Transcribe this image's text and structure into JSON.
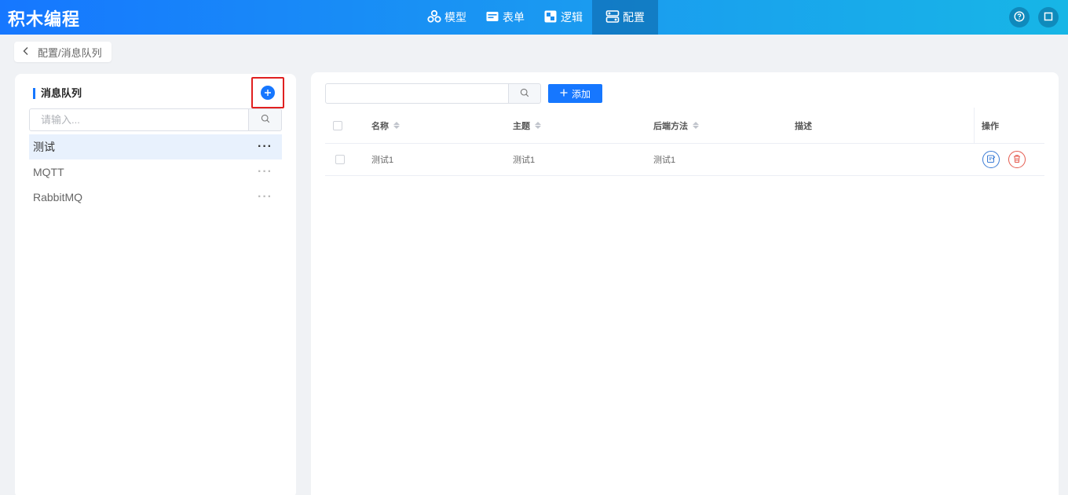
{
  "app": {
    "title": "积木编程"
  },
  "nav": [
    {
      "label": "模型",
      "icon": "model-icon",
      "active": false
    },
    {
      "label": "表单",
      "icon": "form-icon",
      "active": false
    },
    {
      "label": "逻辑",
      "icon": "logic-icon",
      "active": false
    },
    {
      "label": "配置",
      "icon": "config-icon",
      "active": true
    }
  ],
  "header_actions": [
    {
      "icon": "help-icon"
    },
    {
      "icon": "fullscreen-icon"
    }
  ],
  "breadcrumb": {
    "text": "配置/消息队列"
  },
  "sidebar": {
    "title": "消息队列",
    "search_placeholder": "请输入...",
    "items": [
      {
        "label": "测试",
        "active": true
      },
      {
        "label": "MQTT",
        "active": false
      },
      {
        "label": "RabbitMQ",
        "active": false
      }
    ]
  },
  "main": {
    "search_value": "",
    "add_label": "添加",
    "columns": {
      "name": "名称",
      "topic": "主题",
      "backend": "后端方法",
      "desc": "描述",
      "ops": "操作"
    },
    "rows": [
      {
        "name": "测试1",
        "topic": "测试1",
        "backend": "测试1",
        "desc": ""
      }
    ]
  },
  "colors": {
    "primary": "#1677ff",
    "danger": "#e55a4e",
    "highlight": "#e02020"
  }
}
